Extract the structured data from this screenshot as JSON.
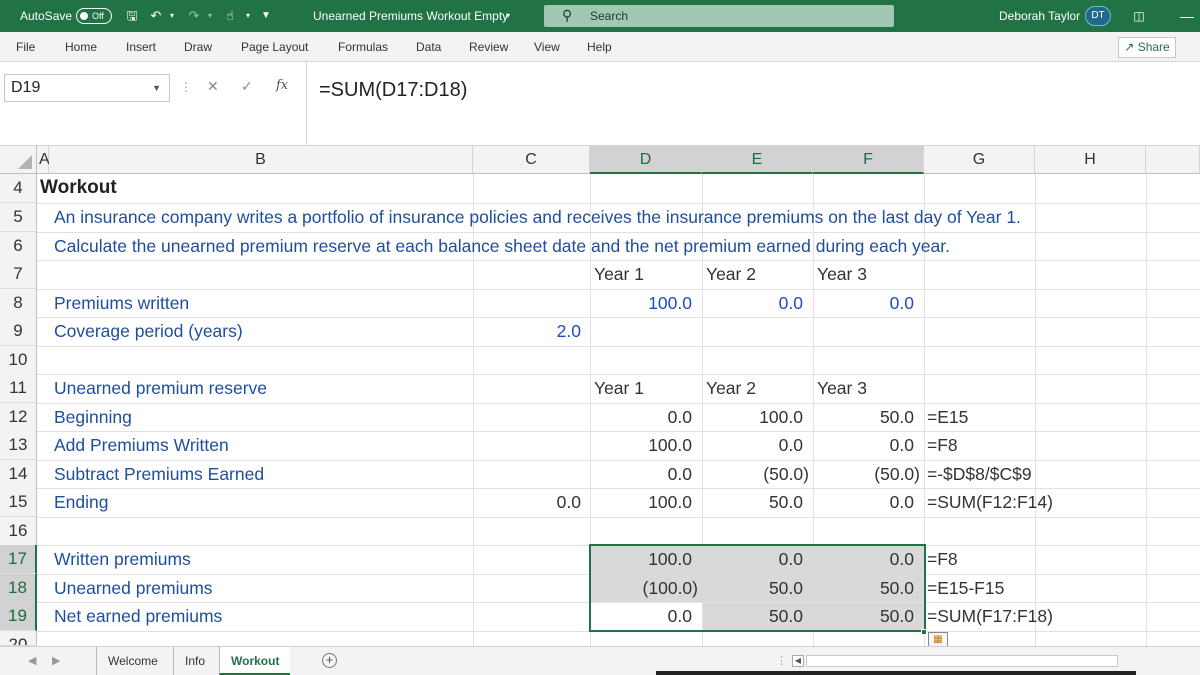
{
  "titlebar": {
    "autosave_label": "AutoSave",
    "autosave_state": "Off",
    "doc_title": "Unearned Premiums Workout Empty",
    "search_placeholder": "Search",
    "user_name": "Deborah Taylor",
    "user_initials": "DT",
    "accent_color": "#217346"
  },
  "ribbon": {
    "tabs": [
      "File",
      "Home",
      "Insert",
      "Draw",
      "Page Layout",
      "Formulas",
      "Data",
      "Review",
      "View",
      "Help"
    ],
    "share_label": "Share"
  },
  "formula_bar": {
    "name_box": "D19",
    "formula": "=SUM(D17:D18)"
  },
  "columns": [
    "A",
    "B",
    "C",
    "D",
    "E",
    "F",
    "G",
    "H"
  ],
  "rows": [
    "4",
    "5",
    "6",
    "7",
    "8",
    "9",
    "10",
    "11",
    "12",
    "13",
    "14",
    "15",
    "16",
    "17",
    "18",
    "19",
    "20"
  ],
  "sheet": {
    "title": "Workout",
    "line5": "An insurance company writes a portfolio of insurance policies and receives the insurance premiums on the last day of Year 1.",
    "line6": "Calculate the unearned premium reserve at each balance sheet date and the net premium earned during each year.",
    "years_header": [
      "Year 1",
      "Year 2",
      "Year 3"
    ],
    "premiums_written": {
      "label": "Premiums written",
      "values": [
        "100.0",
        "0.0",
        "0.0"
      ]
    },
    "coverage_period": {
      "label": "Coverage period (years)",
      "value": "2.0"
    },
    "reserve_header": {
      "label": "Unearned premium reserve",
      "years": [
        "Year 1",
        "Year 2",
        "Year 3"
      ]
    },
    "reserve_rows": [
      {
        "label": "Beginning",
        "c": "",
        "d": "0.0",
        "e": "100.0",
        "f": "50.0",
        "formula": "=E15"
      },
      {
        "label": "Add Premiums Written",
        "c": "",
        "d": "100.0",
        "e": "0.0",
        "f": "0.0",
        "formula": "=F8"
      },
      {
        "label": "Subtract Premiums Earned",
        "c": "",
        "d": "0.0",
        "e": "(50.0)",
        "f": "(50.0)",
        "formula": "=-$D$8/$C$9"
      },
      {
        "label": "Ending",
        "c": "0.0",
        "d": "100.0",
        "e": "50.0",
        "f": "0.0",
        "formula": "=SUM(F12:F14)"
      }
    ],
    "summary_rows": [
      {
        "label": "Written premiums",
        "d": "100.0",
        "e": "0.0",
        "f": "0.0",
        "formula": "=F8"
      },
      {
        "label": "Unearned premiums",
        "d": "(100.0)",
        "e": "50.0",
        "f": "50.0",
        "formula": "=E15-F15"
      },
      {
        "label": "Net earned premiums",
        "d": "0.0",
        "e": "50.0",
        "f": "50.0",
        "formula": "=SUM(F17:F18)"
      }
    ]
  },
  "sheet_tabs": [
    "Welcome",
    "Info",
    "Workout"
  ],
  "active_sheet": "Workout"
}
